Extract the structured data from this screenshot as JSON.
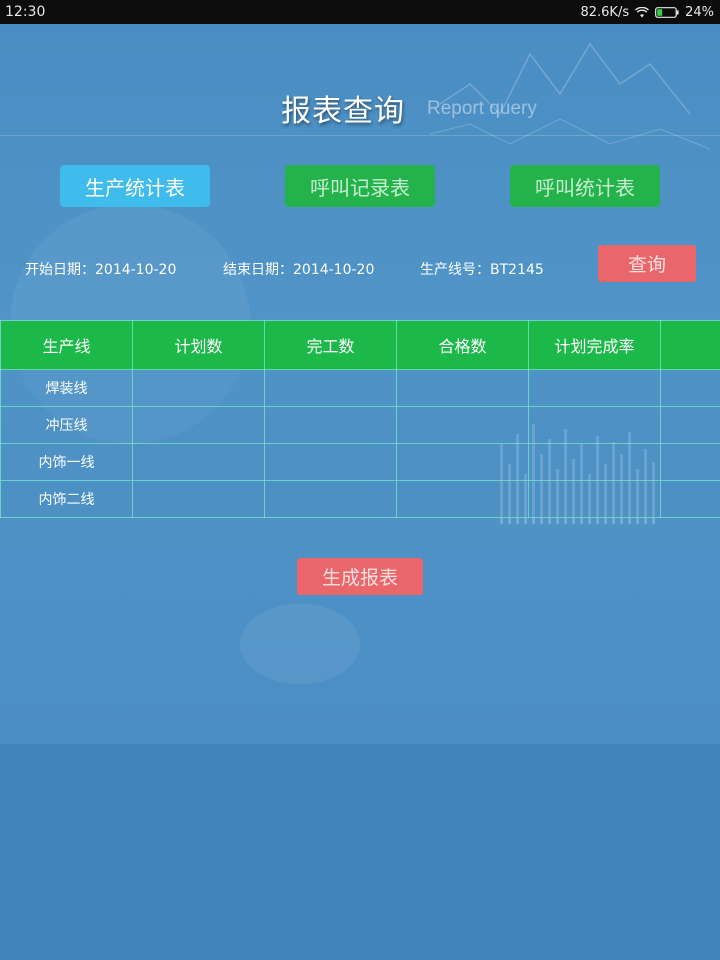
{
  "status_bar": {
    "time": "12:30",
    "net_speed": "82.6K/s",
    "battery": "24%"
  },
  "header": {
    "title": "报表查询",
    "subtitle": "Report query"
  },
  "tabs": [
    {
      "label": "生产统计表",
      "active": true
    },
    {
      "label": "呼叫记录表",
      "active": false
    },
    {
      "label": "呼叫统计表",
      "active": false
    }
  ],
  "filters": {
    "start_date": "开始日期：2014-10-20",
    "end_date": "结束日期：2014-10-20",
    "line_no": "生产线号：BT2145"
  },
  "query_button": "查询",
  "table": {
    "columns": [
      "生产线",
      "计划数",
      "完工数",
      "合格数",
      "计划完成率",
      ""
    ],
    "rows": [
      [
        "焊装线",
        "",
        "",
        "",
        "",
        ""
      ],
      [
        "冲压线",
        "",
        "",
        "",
        "",
        ""
      ],
      [
        "内饰一线",
        "",
        "",
        "",
        "",
        ""
      ],
      [
        "内饰二线",
        "",
        "",
        "",
        "",
        ""
      ]
    ]
  },
  "generate_button": "生成报表",
  "colors": {
    "background": "#3f85bb",
    "tab_active": "#3fbbec",
    "tab_inactive": "#23b34a",
    "table_header": "#1db84a",
    "action_button": "#e9676a"
  }
}
